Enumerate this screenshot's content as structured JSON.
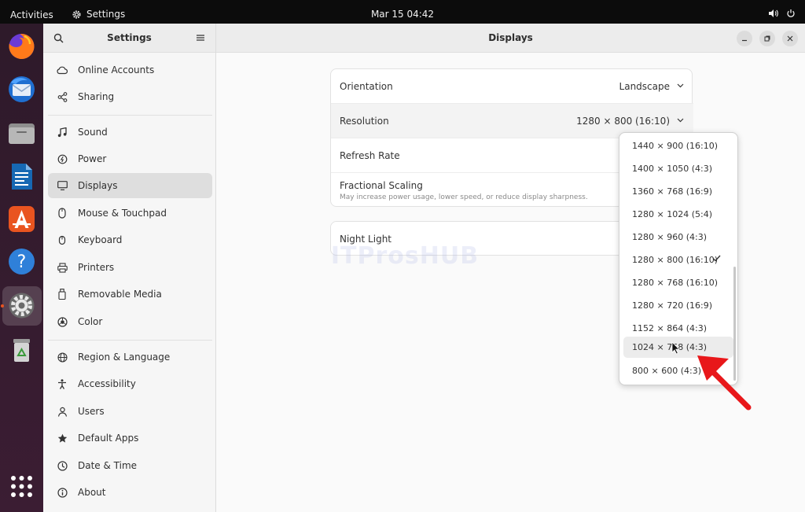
{
  "topbar": {
    "activities": "Activities",
    "app_name": "Settings",
    "clock": "Mar 15  04:42"
  },
  "dock": {
    "items": [
      "firefox-icon",
      "thunderbird-icon",
      "files-icon",
      "libreoffice-writer-icon",
      "app-center-icon",
      "help-icon",
      "settings-icon",
      "trash-icon",
      "show-apps-icon"
    ]
  },
  "sidebar": {
    "title": "Settings",
    "items": [
      {
        "label": "Online Accounts",
        "icon": "cloud-icon"
      },
      {
        "label": "Sharing",
        "icon": "share-icon"
      },
      {
        "label": "Sound",
        "icon": "music-note-icon"
      },
      {
        "label": "Power",
        "icon": "power-icon"
      },
      {
        "label": "Displays",
        "icon": "display-icon",
        "selected": true
      },
      {
        "label": "Mouse & Touchpad",
        "icon": "mouse-icon"
      },
      {
        "label": "Keyboard",
        "icon": "keyboard-icon"
      },
      {
        "label": "Printers",
        "icon": "printer-icon"
      },
      {
        "label": "Removable Media",
        "icon": "usb-icon"
      },
      {
        "label": "Color",
        "icon": "color-icon"
      },
      {
        "label": "Region & Language",
        "icon": "globe-icon"
      },
      {
        "label": "Accessibility",
        "icon": "accessibility-icon"
      },
      {
        "label": "Users",
        "icon": "users-icon"
      },
      {
        "label": "Default Apps",
        "icon": "star-icon"
      },
      {
        "label": "Date & Time",
        "icon": "clock-icon"
      },
      {
        "label": "About",
        "icon": "info-icon"
      }
    ]
  },
  "main": {
    "title": "Displays",
    "orientation": {
      "label": "Orientation",
      "value": "Landscape"
    },
    "resolution": {
      "label": "Resolution",
      "value": "1280 × 800 (16:10)"
    },
    "refresh_rate": {
      "label": "Refresh Rate"
    },
    "fractional_scaling": {
      "label": "Fractional Scaling",
      "subtitle": "May increase power usage, lower speed, or reduce display sharpness."
    },
    "night_light": {
      "label": "Night Light"
    },
    "watermark": "ITProsHUB"
  },
  "resolution_options": [
    {
      "label": "1440 × 900 (16:10)"
    },
    {
      "label": "1400 × 1050 (4:3)"
    },
    {
      "label": "1360 × 768 (16:9)"
    },
    {
      "label": "1280 × 1024 (5:4)"
    },
    {
      "label": "1280 × 960 (4:3)"
    },
    {
      "label": "1280 × 800 (16:10)",
      "selected": true
    },
    {
      "label": "1280 × 768 (16:10)"
    },
    {
      "label": "1280 × 720 (16:9)"
    },
    {
      "label": "1152 × 864 (4:3)"
    },
    {
      "label": "1024 × 768 (4:3)",
      "hovered": true
    },
    {
      "label": "800 × 600 (4:3)"
    }
  ],
  "colors": {
    "accent": "#e95420",
    "annotation_arrow": "#e8171a",
    "dock_bg": "#2e1a2a",
    "topbar_bg": "#0c0c0c"
  }
}
